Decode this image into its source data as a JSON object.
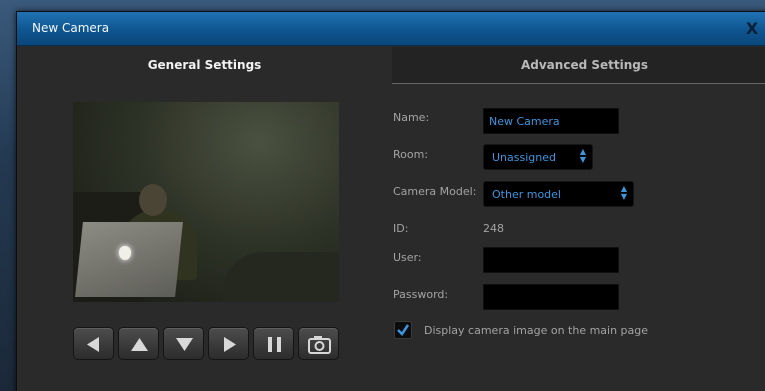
{
  "window": {
    "title": "New Camera",
    "close_label": "X"
  },
  "tabs": [
    {
      "label": "General Settings",
      "active": true
    },
    {
      "label": "Advanced Settings",
      "active": false
    }
  ],
  "form": {
    "name_label": "Name:",
    "name_value": "New Camera",
    "room_label": "Room:",
    "room_value": "Unassigned",
    "model_label": "Camera Model:",
    "model_value": "Other model",
    "id_label": "ID:",
    "id_value": "248",
    "user_label": "User:",
    "user_value": "",
    "password_label": "Password:",
    "password_value": "",
    "display_checkbox_label": "Display camera image on the main page",
    "display_checked": true
  },
  "ptz_controls": [
    {
      "icon": "arrow-left-icon"
    },
    {
      "icon": "arrow-up-icon"
    },
    {
      "icon": "arrow-down-icon"
    },
    {
      "icon": "arrow-right-icon"
    },
    {
      "icon": "pause-icon"
    },
    {
      "icon": "camera-icon"
    }
  ],
  "colors": {
    "title_bar": "#0f5590",
    "accent_text": "#3d95e0",
    "panel_bg": "#2a2a2a"
  }
}
